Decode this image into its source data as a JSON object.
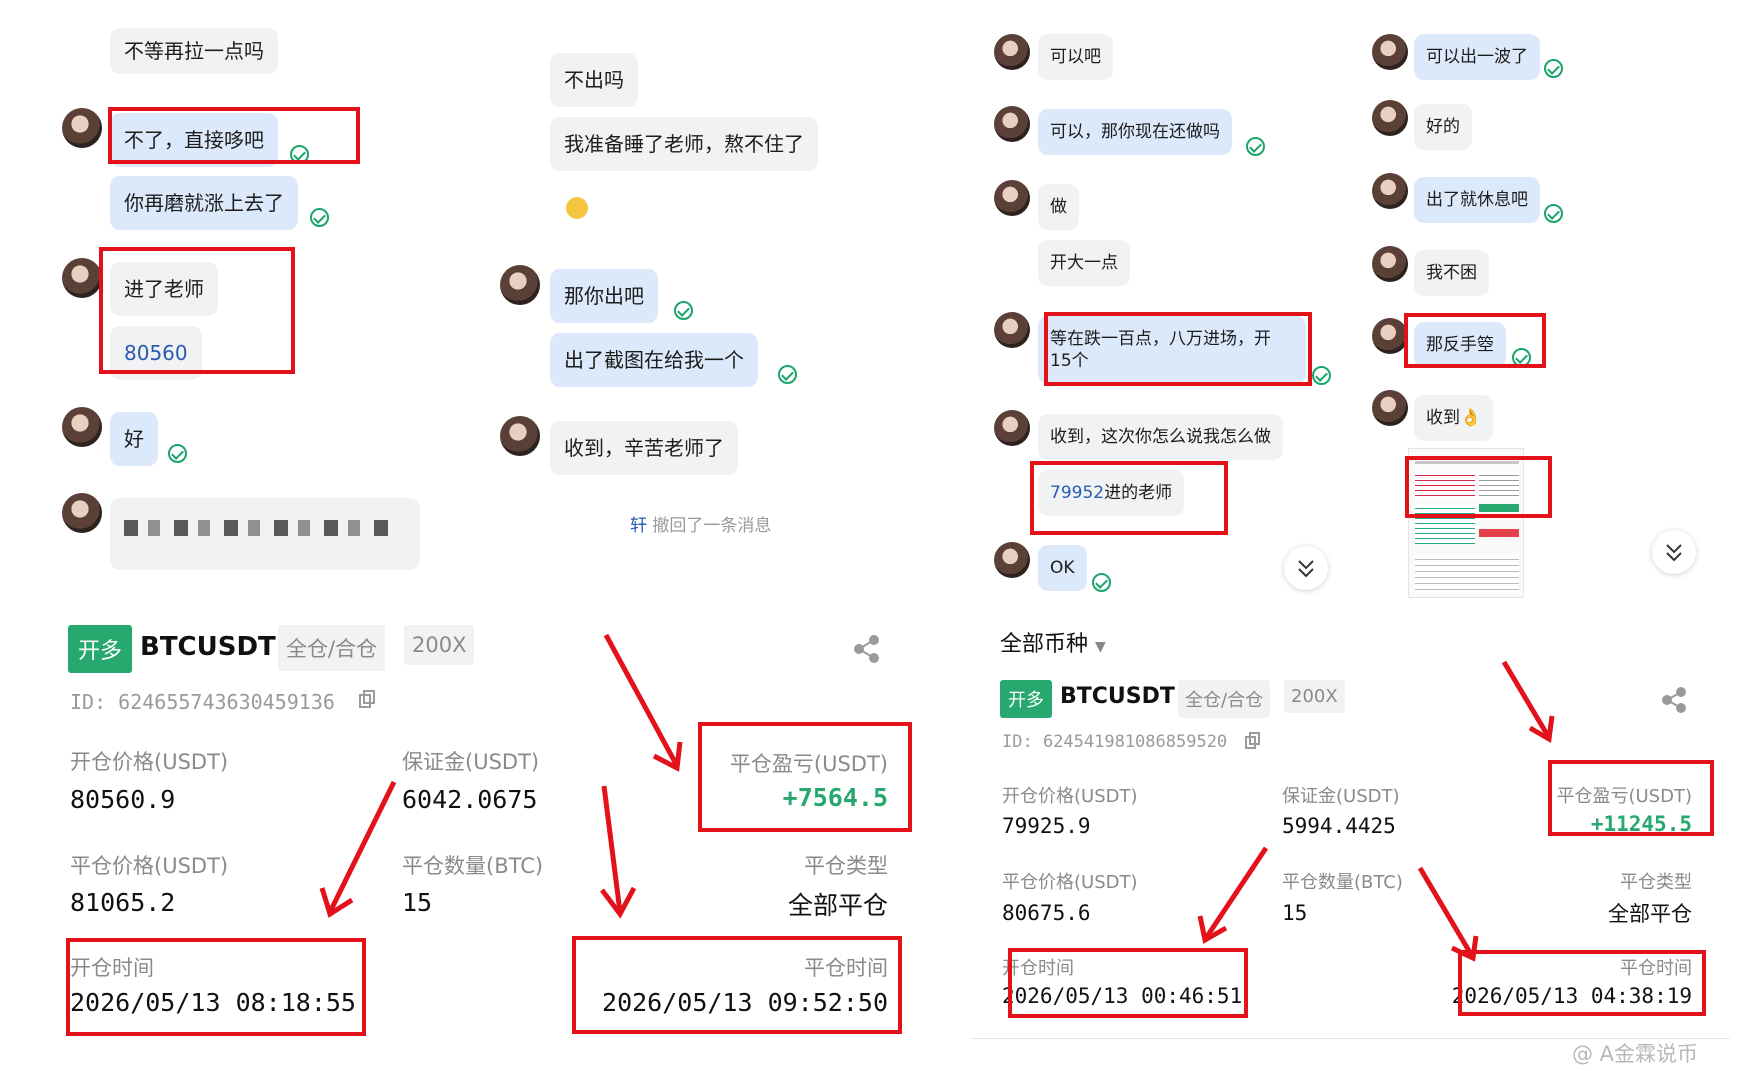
{
  "left_chat": {
    "col1": {
      "msg_top": "不等再拉一点吗",
      "msg1": "不了，直接哆吧",
      "msg2": "你再磨就涨上去了",
      "msg3": "进了老师",
      "msg4": "80560",
      "msg5": "好"
    },
    "col2": {
      "msg1": "不出吗",
      "msg2": "我准备睡了老师，熬不住了",
      "msg3": "那你出吧",
      "msg4": "出了截图在给我一个",
      "msg5": "收到，辛苦老师了",
      "recall_name": "轩",
      "recall_text": "撤回了一条消息"
    }
  },
  "right_chat": {
    "col1": {
      "msg1": "可以吧",
      "msg2": "可以，那你现在还做吗",
      "msg3": "做",
      "msg4": "开大一点",
      "msg5_line1": "等在跌一百点，八万进场，开",
      "msg5_line2": "15个",
      "msg6": "收到，这次你怎么说我怎么做",
      "msg7_num": "79952",
      "msg7_rest": "进的老师",
      "msg8": "OK"
    },
    "col2": {
      "msg1": "可以出一波了",
      "msg2": "好的",
      "msg3": "出了就休息吧",
      "msg4": "我不困",
      "msg5": "那反手箜",
      "msg6": "收到👌"
    }
  },
  "left_trade": {
    "side": "开多",
    "symbol": "BTCUSDT",
    "margin_mode": "全仓/合仓",
    "leverage": "200X",
    "id": "ID: 624655743630459136",
    "open_price_label": "开仓价格(USDT)",
    "open_price": "80560.9",
    "margin_label": "保证金(USDT)",
    "margin": "6042.0675",
    "pnl_label": "平仓盈亏(USDT)",
    "pnl": "+7564.5",
    "close_price_label": "平仓价格(USDT)",
    "close_price": "81065.2",
    "close_qty_label": "平仓数量(BTC)",
    "close_qty": "15",
    "close_type_label": "平仓类型",
    "close_type": "全部平仓",
    "open_time_label": "开仓时间",
    "open_time": "2026/05/13 08:18:55",
    "close_time_label": "平仓时间",
    "close_time": "2026/05/13 09:52:50"
  },
  "right_trade": {
    "filter": "全部币种",
    "side": "开多",
    "symbol": "BTCUSDT",
    "margin_mode": "全仓/合仓",
    "leverage": "200X",
    "id": "ID: 624541981086859520",
    "open_price_label": "开仓价格(USDT)",
    "open_price": "79925.9",
    "margin_label": "保证金(USDT)",
    "margin": "5994.4425",
    "pnl_label": "平仓盈亏(USDT)",
    "pnl": "+11245.5",
    "close_price_label": "平仓价格(USDT)",
    "close_price": "80675.6",
    "close_qty_label": "平仓数量(BTC)",
    "close_qty": "15",
    "close_type_label": "平仓类型",
    "close_type": "全部平仓",
    "open_time_label": "开仓时间",
    "open_time": "2026/05/13 00:46:51",
    "close_time_label": "平仓时间",
    "close_time": "2026/05/13 04:38:19"
  },
  "watermark": "@ A金霖说币",
  "colors": {
    "accent_red": "#e3121a",
    "profit_green": "#26a86e",
    "bubble_blue": "#dce9fb",
    "bubble_gray": "#f1f2f4"
  }
}
